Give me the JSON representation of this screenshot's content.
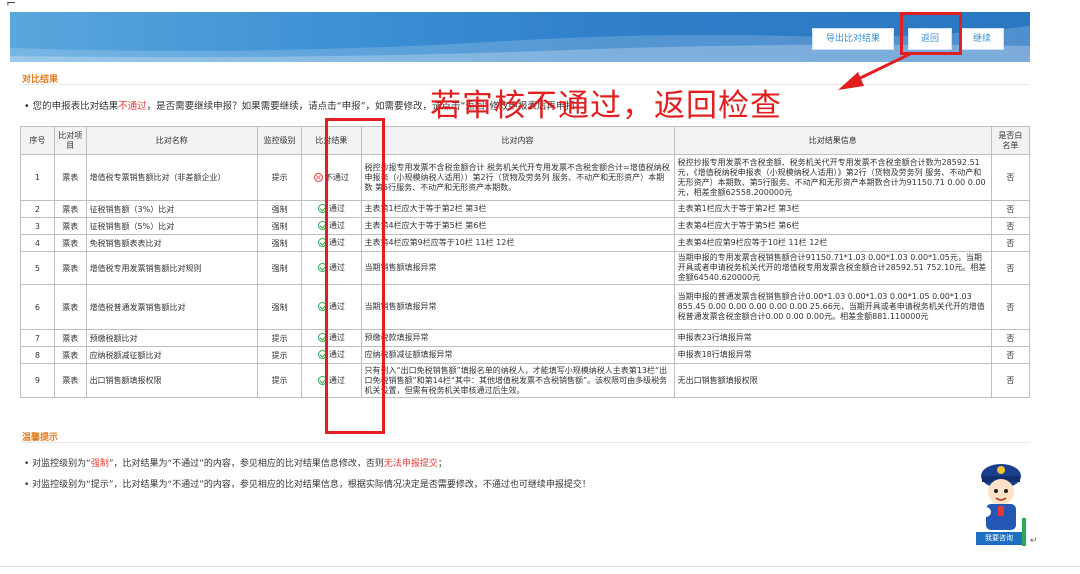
{
  "toolbar": {
    "export_label": "导出比对结果",
    "back_label": "返回",
    "continue_label": "继续"
  },
  "sections": {
    "compare_result": "对比结果",
    "tips": "温馨提示"
  },
  "notice": {
    "prefix": "您的申报表比对结果",
    "status": "不通过",
    "suffix": "，是否需要继续申报？如果需要继续，请点击“申报”，如需要修改，请点击“返回”修改申报表后再申报！"
  },
  "annotation": "若审核不通过，返回检查",
  "table": {
    "headers": [
      "序号",
      "比对项目",
      "比对名称",
      "监控级别",
      "比对结果",
      "比对内容",
      "比对结果信息",
      "是否白名单"
    ],
    "rows": [
      {
        "no": "1",
        "item": "票表",
        "name": "增值税专票销售额比对（非差额企业）",
        "level": "提示",
        "result": "不通过",
        "pass": false,
        "content": "税控抄报专用发票不含税金额合计 税务机关代开专用发票不含税金额合计=增值税纳税申报表（小规模纳税人适用））第2行（货物及劳务列 服务、不动产和无形资产）本期数 第5行服务、不动产和无形资产本期数。",
        "info": "税控抄报专用发票不含税金额、税务机关代开专用发票不含税金额合计数为28592.51元，《增值税纳税申报表（小规模纳税人适用）》第2行（货物及劳务列 服务、不动产和无形资产）本期数、第5行服务、不动产和无形资产本期数合计为91150.71 0.00 0.00元，相差金额62558.200000元",
        "white": "否"
      },
      {
        "no": "2",
        "item": "票表",
        "name": "征税销售额（3%）比对",
        "level": "强制",
        "result": "通过",
        "pass": true,
        "content": "主表第1栏应大于等于第2栏 第3栏",
        "info": "主表第1栏应大于等于第2栏 第3栏",
        "white": "否"
      },
      {
        "no": "3",
        "item": "票表",
        "name": "征税销售额（5%）比对",
        "level": "强制",
        "result": "通过",
        "pass": true,
        "content": "主表第4栏应大于等于第5栏 第6栏",
        "info": "主表第4栏应大于等于第5栏 第6栏",
        "white": "否"
      },
      {
        "no": "4",
        "item": "票表",
        "name": "免税销售额表表比对",
        "level": "强制",
        "result": "通过",
        "pass": true,
        "content": "主表第4栏应第9栏应等于10栏 11栏 12栏",
        "info": "主表第4栏应第9栏应等于10栏 11栏 12栏",
        "white": "否"
      },
      {
        "no": "5",
        "item": "票表",
        "name": "增值税专用发票销售额比对规则",
        "level": "强制",
        "result": "通过",
        "pass": true,
        "content": "当期销售额填报异常",
        "info": "当期申报的专用发票含税销售额合计91150.71*1.03 0.00*1.03 0.00*1.05元，当期开具或者申请税务机关代开的增值税专用发票含税金额合计28592.51 752.10元。相差金额64540.620000元",
        "white": "否"
      },
      {
        "no": "6",
        "item": "票表",
        "name": "增值税普通发票销售额比对",
        "level": "强制",
        "result": "通过",
        "pass": true,
        "content": "当期销售额填报异常",
        "info": "当期申报的普通发票含税销售额合计0.00*1.03 0.00*1.03 0.00*1.05 0.00*1.03 855.45 0.00 0.00 0.00 0.00 0.00 25.66元，当期开具或者申请税务机关代开的增值税普通发票含税金额合计0.00 0.00 0.00元。相差金额881.110000元",
        "white": "否"
      },
      {
        "no": "7",
        "item": "票表",
        "name": "预缴税额比对",
        "level": "提示",
        "result": "通过",
        "pass": true,
        "content": "预缴税款填报异常",
        "info": "申报表23行填报异常",
        "white": "否"
      },
      {
        "no": "8",
        "item": "票表",
        "name": "应纳税额减征额比对",
        "level": "提示",
        "result": "通过",
        "pass": true,
        "content": "应纳税额减征额填报异常",
        "info": "申报表18行填报异常",
        "white": "否"
      },
      {
        "no": "9",
        "item": "票表",
        "name": "出口销售额填报权限",
        "level": "提示",
        "result": "通过",
        "pass": true,
        "content": "只有列入“出口免税销售额”填报名单的纳税人，才能填写小规模纳税人主表第13栏“出口免税销售额”和第14栏“其中：其他增值税发票不含税销售额”。该权限可由多级税务机关设置，但需有税务机关审核通过后生效。",
        "info": "无出口销售额填报权限",
        "white": "否"
      }
    ]
  },
  "tips": [
    {
      "prefix": "对监控级别为“",
      "highlight1": "强制",
      "middle": "”，比对结果为“不通过”的内容，参见相应的比对结果信息修改，否则",
      "highlight2": "无法申报提交",
      "suffix": "；"
    },
    {
      "text": "对监控级别为“提示”，比对结果为“不通过”的内容，参见相应的比对结果信息，根据实际情况决定是否需要修改，不通过也可继续申报提交！"
    }
  ],
  "assistant": {
    "label": "我要咨询"
  },
  "colors": {
    "banner": "#2f7fc9",
    "section_title": "#e07b1f",
    "alert_red": "#e53935",
    "pass_green": "#2eaa52"
  }
}
